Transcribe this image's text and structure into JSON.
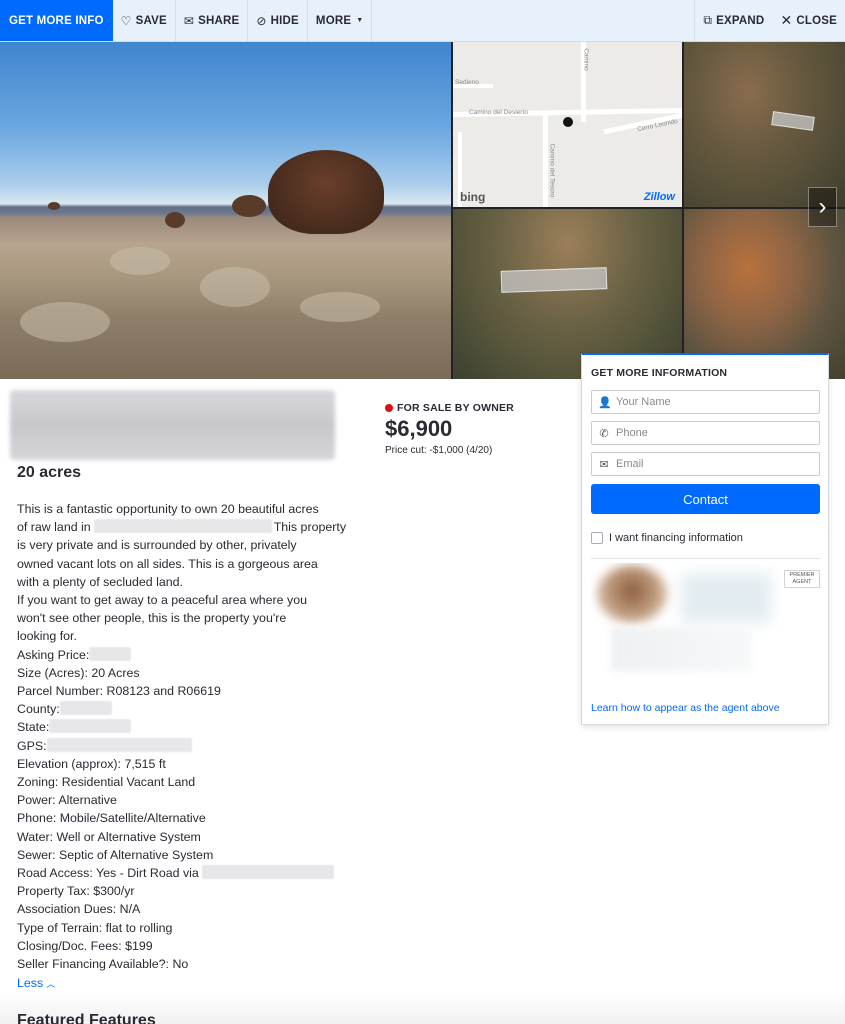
{
  "toolbar": {
    "get_more_info": "GET MORE INFO",
    "save": "SAVE",
    "share": "SHARE",
    "hide": "HIDE",
    "more": "MORE",
    "expand": "EXPAND",
    "close": "CLOSE"
  },
  "map": {
    "labels": [
      "Sedieno",
      "Camino del Desierto",
      "Cerro Leonido",
      "Camino del Tesoro",
      "Camino"
    ],
    "provider": "bing",
    "brand": "Zillow"
  },
  "listing": {
    "acres_heading": "20 acres",
    "status": "FOR SALE BY OWNER",
    "status_color": "#d11111",
    "price": "$6,900",
    "price_cut": "Price cut: -$1,000 (4/20)",
    "description_lines": [
      "This is a fantastic opportunity to own 20 beautiful acres",
      "of raw land in",
      "This property",
      "is very private and is surrounded by other, privately",
      "owned vacant lots on all sides. This is a gorgeous area",
      "with a plenty of secluded land.",
      "If you want to get away to a peaceful area where you",
      "won't see other people, this is the property you're",
      "looking for."
    ],
    "facts": {
      "asking_price": "Asking Price:",
      "size": "Size (Acres): 20 Acres",
      "parcel": "Parcel Number: R08123 and R06619",
      "county": "County:",
      "state": "State:",
      "gps": "GPS:",
      "elevation": "Elevation (approx): 7,515 ft",
      "zoning": "Zoning: Residential Vacant Land",
      "power": "Power: Alternative",
      "phone": "Phone: Mobile/Satellite/Alternative",
      "water": "Water: Well or Alternative System",
      "sewer": "Sewer: Septic of Alternative System",
      "road": "Road Access: Yes - Dirt Road via",
      "tax": "Property Tax: $300/yr",
      "dues": "Association Dues: N/A",
      "terrain": "Type of Terrain: flat to rolling",
      "closing": "Closing/Doc. Fees: $199",
      "financing": "Seller Financing Available?: No"
    },
    "less": "Less"
  },
  "form": {
    "title": "GET MORE INFORMATION",
    "name_placeholder": "Your Name",
    "phone_placeholder": "Phone",
    "email_placeholder": "Email",
    "contact_label": "Contact",
    "financing_label": "I want financing information",
    "premier_badge": "PREMIER AGENT",
    "learn_link": "Learn how to appear as the agent above"
  },
  "next_section_heading": "Featured Features",
  "colors": {
    "accent": "#006aff",
    "toolbar_bg": "#e6f1fb"
  }
}
